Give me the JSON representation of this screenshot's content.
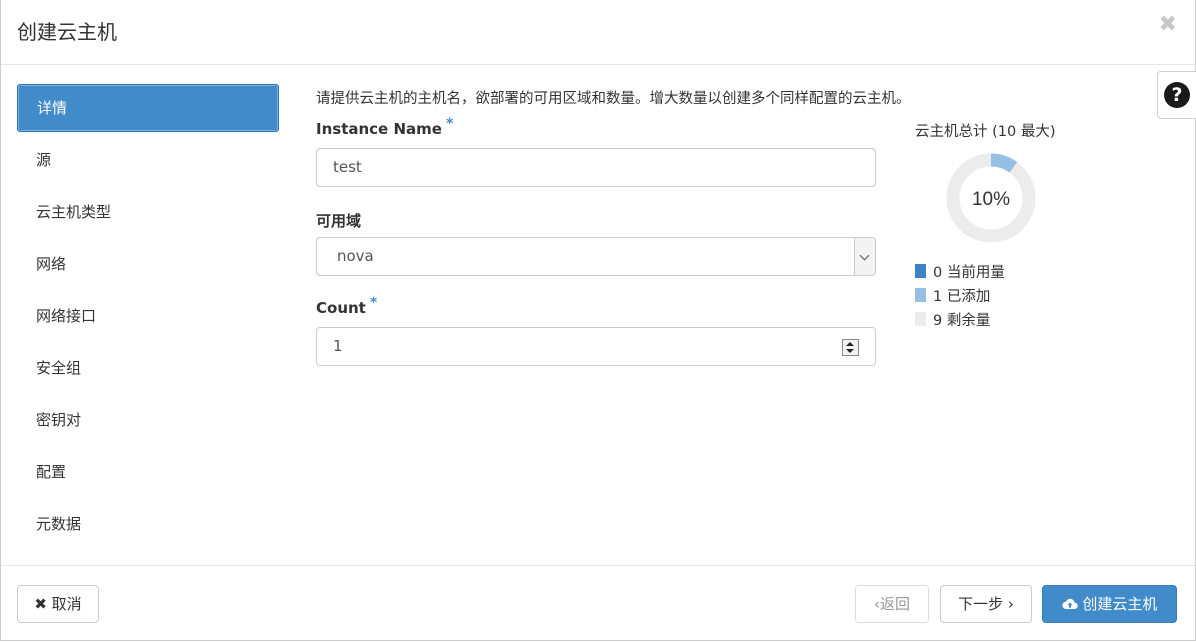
{
  "dialog": {
    "title": "创建云主机",
    "close_glyph": "✖",
    "help_glyph": "?"
  },
  "nav": {
    "items": [
      {
        "label": "详情",
        "active": true
      },
      {
        "label": "源"
      },
      {
        "label": "云主机类型"
      },
      {
        "label": "网络"
      },
      {
        "label": "网络接口"
      },
      {
        "label": "安全组"
      },
      {
        "label": "密钥对"
      },
      {
        "label": "配置"
      },
      {
        "label": "元数据"
      }
    ]
  },
  "form": {
    "description": "请提供云主机的主机名，欲部署的可用区域和数量。增大数量以创建多个同样配置的云主机。",
    "instance_name": {
      "label": "Instance Name",
      "required_mark": "*",
      "value": "test"
    },
    "availability_zone": {
      "label": "可用域",
      "selected": "nova"
    },
    "count": {
      "label": "Count",
      "required_mark": "*",
      "value": "1"
    }
  },
  "quota": {
    "title": "云主机总计 (10 最大)",
    "percent_text": "10%",
    "used": 0,
    "added": 1,
    "remaining": 9,
    "max": 10,
    "legend": [
      {
        "value": "0",
        "label": "当前用量",
        "color": "#3f82c3"
      },
      {
        "value": "1",
        "label": "已添加",
        "color": "#97bfe3"
      },
      {
        "value": "9",
        "label": "剩余量",
        "color": "#ececec"
      }
    ]
  },
  "footer": {
    "cancel_label": "取消",
    "back_label": "返回",
    "next_label": "下一步",
    "create_label": "创建云主机"
  },
  "colors": {
    "primary": "#428bca",
    "required": "#428bca"
  }
}
